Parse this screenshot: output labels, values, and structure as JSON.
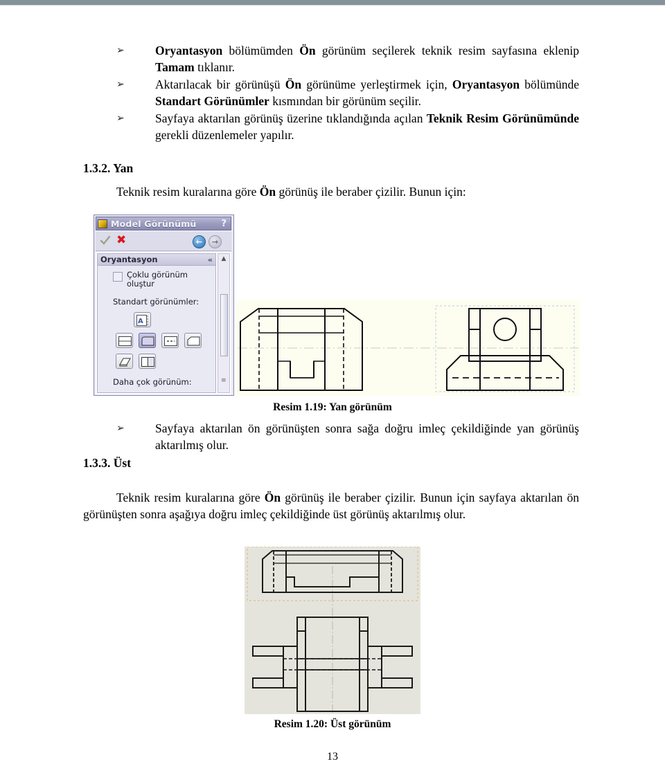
{
  "document": {
    "page_number": "13",
    "bullets_top": [
      {
        "glyph": "➢",
        "html": "<b>Oryantasyon</b> bölümümden <b>Ön</b> görünüm seçilerek teknik resim sayfasına eklenip <b>Tamam</b> tıklanır."
      },
      {
        "glyph": "➢",
        "html": "Aktarılacak bir görünüşü <b>Ön</b> görünüme yerleştirmek için, <b>Oryantasyon</b> bölümünde <b>Standart Görünümler</b> kısmından bir görünüm seçilir."
      },
      {
        "glyph": "➢",
        "html": "Sayfaya aktarılan görünüş üzerine tıklandığında açılan <b>Teknik Resim Görünümünde</b> gerekli düzenlemeler yapılır."
      }
    ],
    "heading_132": "1.3.2. Yan",
    "para_132_html": "Teknik resim kuralarına göre <b>Ön</b> görünüş ile beraber çizilir. Bunun için:",
    "caption_119": "Resim 1.19: Yan görünüm",
    "bullet_after_119": {
      "glyph": "➢",
      "html": "Sayfaya aktarılan ön görünüşten sonra sağa doğru imleç çekildiğinde yan görünüş aktarılmış olur."
    },
    "heading_133": "1.3.3. Üst",
    "para_133_html": "Teknik resim kuralarına göre <b>Ön</b> görünüş ile beraber çizilir. Bunun için sayfaya aktarılan ön görünüşten sonra aşağıya doğru imleç çekildiğinde üst görünüş aktarılmış olur.",
    "caption_120": "Resim 1.20: Üst görünüm"
  },
  "solidworks_panel": {
    "title": "Model Görünümü",
    "help_label": "?",
    "ok_label": "ok-check",
    "cancel_label": "✖",
    "nav_back": "←",
    "nav_forward": "→",
    "group_title": "Oryantasyon",
    "group_collapse": "«",
    "checkbox_label": "Çoklu görünüm oluştur",
    "checkbox_checked": false,
    "standard_views_label": "Standart görünümler:",
    "more_views_label": "Daha çok görünüm:",
    "view_buttons": [
      {
        "name": "current-model-view",
        "row": 1,
        "selected": false
      },
      {
        "name": "front-view",
        "row": 2,
        "selected": false
      },
      {
        "name": "left-view",
        "row": 2,
        "selected": true
      },
      {
        "name": "right-view",
        "row": 2,
        "selected": false
      },
      {
        "name": "top-view",
        "row": 2,
        "selected": false
      },
      {
        "name": "isometric-view",
        "row": 3,
        "selected": false
      },
      {
        "name": "two-view",
        "row": 3,
        "selected": false
      }
    ],
    "scrollbar_up": "▲"
  },
  "colors": {
    "top_bar": "#84929a",
    "panel_bg": "#e8e8f2",
    "titlebar": "#9c9cc0",
    "drawing_bg_119": "#fdfdf0",
    "drawing_bg_120": "#e4e4dc",
    "selection_outline_119": "#b8cfe0",
    "selection_outline_120": "#d8b878",
    "line": "#101010"
  }
}
